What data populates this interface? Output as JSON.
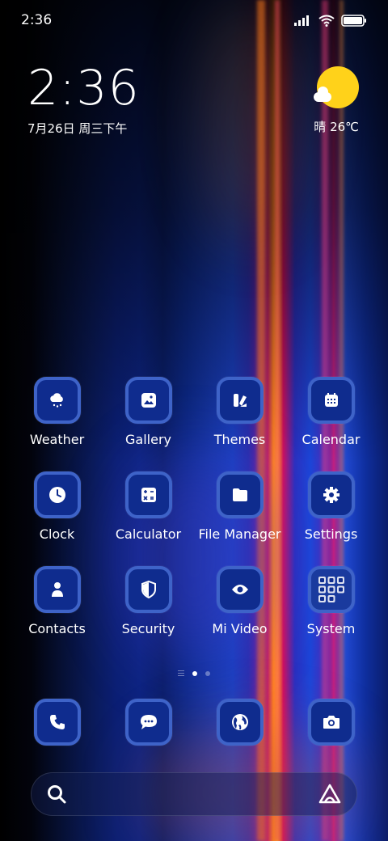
{
  "status_bar": {
    "time": "2:36"
  },
  "clock_widget": {
    "time": "2:36",
    "date": "7月26日 周三下午"
  },
  "weather_widget": {
    "summary": "晴 26℃"
  },
  "apps": [
    {
      "label": "Weather",
      "icon": "weather-icon"
    },
    {
      "label": "Gallery",
      "icon": "gallery-icon"
    },
    {
      "label": "Themes",
      "icon": "themes-icon"
    },
    {
      "label": "Calendar",
      "icon": "calendar-icon"
    },
    {
      "label": "Clock",
      "icon": "clock-icon"
    },
    {
      "label": "Calculator",
      "icon": "calculator-icon"
    },
    {
      "label": "File Manager",
      "icon": "folder-icon"
    },
    {
      "label": "Settings",
      "icon": "gear-icon"
    },
    {
      "label": "Contacts",
      "icon": "person-icon"
    },
    {
      "label": "Security",
      "icon": "shield-icon"
    },
    {
      "label": "Mi Video",
      "icon": "eye-icon"
    },
    {
      "label": "System",
      "icon": "folder-grid-icon"
    }
  ],
  "dock": [
    {
      "icon": "phone-icon"
    },
    {
      "icon": "message-icon"
    },
    {
      "icon": "globe-icon"
    },
    {
      "icon": "camera-icon"
    }
  ],
  "colors": {
    "tile_fill": "#0f2c8e",
    "tile_border": "#3e63c8",
    "sun": "#ffd21a"
  }
}
